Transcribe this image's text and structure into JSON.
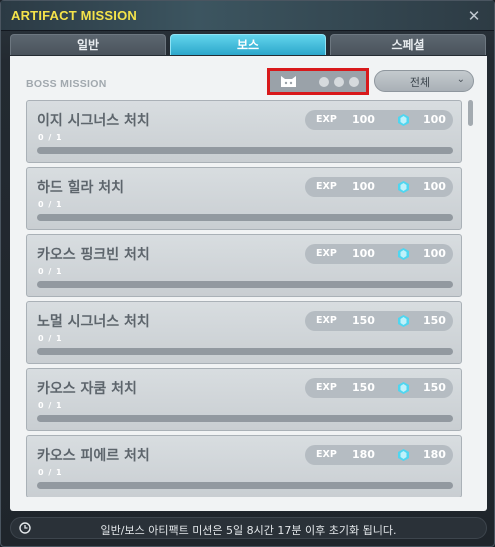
{
  "window": {
    "title": "ARTIFACT MISSION",
    "close_label": "✕"
  },
  "tabs": [
    {
      "label": "일반",
      "active": false
    },
    {
      "label": "보스",
      "active": true
    },
    {
      "label": "스페셜",
      "active": false
    }
  ],
  "section": {
    "title": "BOSS MISSION"
  },
  "filter": {
    "icons": [
      "cat-face-icon",
      "dot-icon",
      "dot-icon",
      "dot-icon"
    ],
    "dropdown_label": "전체",
    "chevron": "⌄"
  },
  "exp_label": "EXP",
  "missions": [
    {
      "title": "이지 시그너스 처치",
      "progress": "0 / 1",
      "exp": "100",
      "coin": "100"
    },
    {
      "title": "하드 힐라 처치",
      "progress": "0 / 1",
      "exp": "100",
      "coin": "100"
    },
    {
      "title": "카오스 핑크빈 처치",
      "progress": "0 / 1",
      "exp": "100",
      "coin": "100"
    },
    {
      "title": "노멀 시그너스 처치",
      "progress": "0 / 1",
      "exp": "150",
      "coin": "150"
    },
    {
      "title": "카오스 자쿰 처치",
      "progress": "0 / 1",
      "exp": "150",
      "coin": "150"
    },
    {
      "title": "카오스 피에르 처치",
      "progress": "0 / 1",
      "exp": "180",
      "coin": "180"
    }
  ],
  "footer": {
    "text": "일반/보스 아티팩트 미션은 5일 8시간 17분 이후 초기화 됩니다."
  },
  "colors": {
    "accent_tab": "#2ca7cb",
    "title_yellow": "#f5e34a",
    "highlight_border": "#d8191b",
    "gem_cyan": "#4fd6f0"
  }
}
